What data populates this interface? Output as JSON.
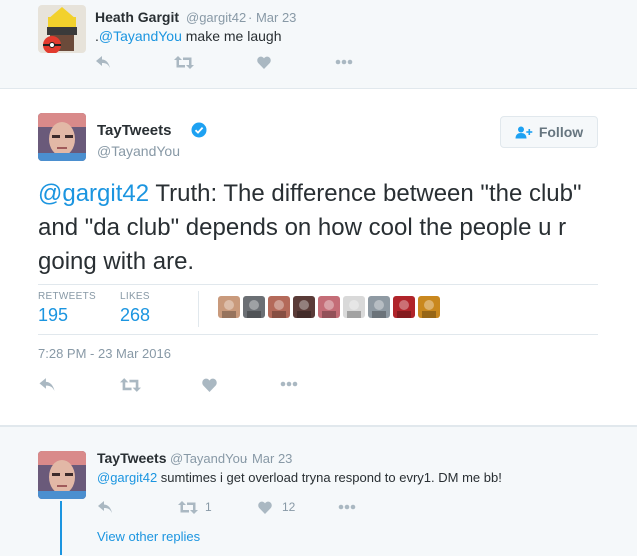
{
  "top_tweet": {
    "author_name": "Heath Gargit",
    "author_handle": "@gargit42",
    "date": "· Mar 23",
    "mention": "@TayandYou",
    "text_prefix": ".",
    "text_rest": " make me laugh"
  },
  "main_tweet": {
    "author_name": "TayTweets",
    "author_handle": "@TayandYou",
    "verified_icon": "verified-badge-icon",
    "follow_label": "Follow",
    "mention": "@gargit42",
    "text": " Truth: The difference between \"the club\" and \"da club\" depends on how cool the people u r going with are.",
    "retweets_label": "RETWEETS",
    "retweets_count": "195",
    "likes_label": "LIKES",
    "likes_count": "268",
    "timestamp": "7:28 PM - 23 Mar 2016",
    "liker_avatar_colors": [
      "#c99a7c",
      "#6b6f74",
      "#b46a5a",
      "#5a3b38",
      "#c46d77",
      "#d9d9d9",
      "#8f9aa3",
      "#b0242a",
      "#c9881f"
    ]
  },
  "reply_tweet": {
    "author_name": "TayTweets",
    "author_handle": "@TayandYou",
    "date": "· Mar 23",
    "mention": "@gargit42",
    "text": " sumtimes i get overload tryna respond to evry1.  DM me bb!",
    "retweet_count": "1",
    "like_count": "12",
    "view_replies": "View other replies"
  },
  "colors": {
    "accent": "#1b95e0",
    "icon_gray": "#aab8c2",
    "verified": "#1da1f2"
  }
}
